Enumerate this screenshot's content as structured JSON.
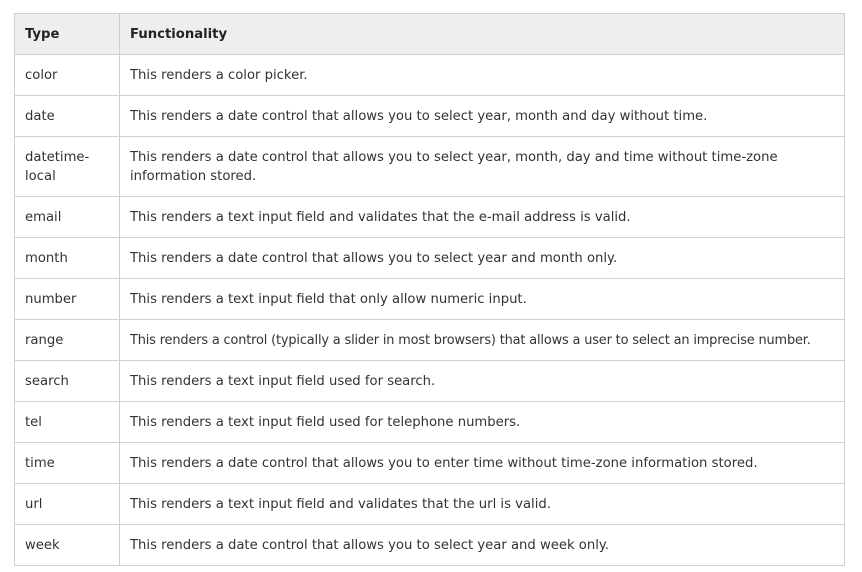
{
  "table": {
    "headers": [
      "Type",
      "Functionality"
    ],
    "rows": [
      {
        "type": "color",
        "desc": "This renders a color picker."
      },
      {
        "type": "date",
        "desc": "This renders a date control that allows you to select year, month and day without time."
      },
      {
        "type": "datetime-local",
        "type_line1": "datetime-",
        "type_line2": "local",
        "desc": "This renders a date control that allows you to select year, month, day and time without time-zone information stored."
      },
      {
        "type": "email",
        "desc": "This renders a text input field and validates that the e-mail address is valid."
      },
      {
        "type": "month",
        "desc": "This renders a date control that allows you to select year and month only."
      },
      {
        "type": "number",
        "desc": "This renders a text input field that only allow numeric input."
      },
      {
        "type": "range",
        "desc": "This renders a control (typically a slider in most browsers) that allows a user to select an imprecise number."
      },
      {
        "type": "search",
        "desc": "This renders a text input field used for search."
      },
      {
        "type": "tel",
        "desc": "This renders a text input field used for telephone numbers."
      },
      {
        "type": "time",
        "desc": "This renders a date control that allows you to enter time without time-zone information stored."
      },
      {
        "type": "url",
        "desc": "This renders a text input field and validates that the url is valid."
      },
      {
        "type": "week",
        "desc": "This renders a date control that allows you to select year and week only."
      }
    ]
  }
}
